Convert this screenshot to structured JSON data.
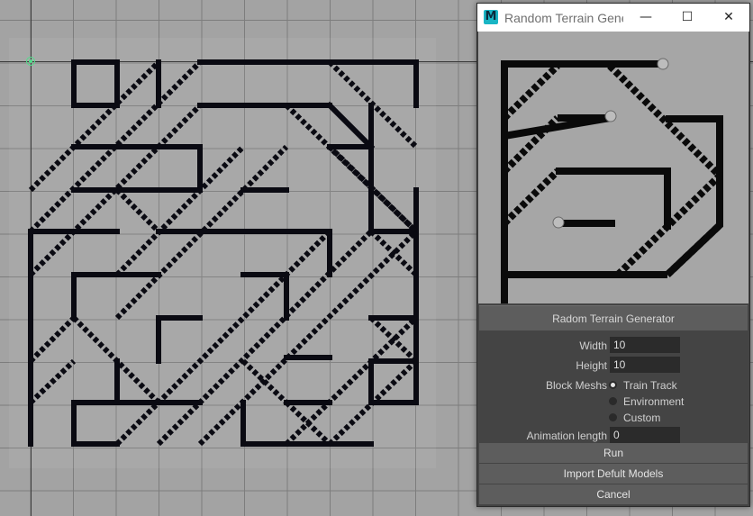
{
  "window": {
    "title": "Random Terrain Gene...",
    "app_icon_letter": "M",
    "minimize_glyph": "—",
    "maximize_glyph": "☐",
    "close_glyph": "✕"
  },
  "panel": {
    "header": "Radom Terrain Generator",
    "width_label": "Width",
    "width_value": "10",
    "height_label": "Height",
    "height_value": "10",
    "block_meshes_label": "Block Meshs",
    "block_meshes_options": [
      "Train Track",
      "Environment",
      "Custom"
    ],
    "block_meshes_selected": "Train Track",
    "animation_label": "Animation length",
    "animation_value": "0"
  },
  "buttons": {
    "run": "Run",
    "import": "Import Defult Models",
    "cancel": "Cancel"
  },
  "colors": {
    "viewport_bg": "#a3a3a3",
    "track": "#0a0a12",
    "panel_bg": "#444444",
    "button_bg": "#5d5d5d",
    "pivot": "#4fe08a"
  }
}
